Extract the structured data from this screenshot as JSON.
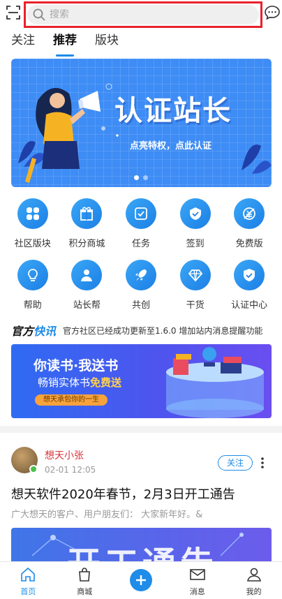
{
  "search": {
    "placeholder": "搜索"
  },
  "tabs": [
    {
      "label": "关注"
    },
    {
      "label": "推荐",
      "active": true
    },
    {
      "label": "版块"
    }
  ],
  "banner": {
    "title": "认证站长",
    "subtitle": "点亮特权，点此认证",
    "page_count": 2,
    "current_page": 1
  },
  "grid": [
    {
      "label": "社区版块",
      "icon": "apps-icon"
    },
    {
      "label": "积分商城",
      "icon": "gift-icon"
    },
    {
      "label": "任务",
      "icon": "task-icon"
    },
    {
      "label": "签到",
      "icon": "checkin-icon"
    },
    {
      "label": "免费版",
      "icon": "free-icon"
    },
    {
      "label": "帮助",
      "icon": "bulb-icon"
    },
    {
      "label": "站长帮",
      "icon": "person-icon"
    },
    {
      "label": "共创",
      "icon": "rocket-icon"
    },
    {
      "label": "干货",
      "icon": "diamond-icon"
    },
    {
      "label": "认证中心",
      "icon": "shield-icon"
    }
  ],
  "news": {
    "logo_a": "官方",
    "logo_b": "快讯",
    "text": "官方社区已经成功更新至1.6.0 增加站内消息提醒功能"
  },
  "ad": {
    "title": "你读书·我送书",
    "sub_a": "畅销实体书",
    "sub_b": "免费送",
    "tag": "想天承包你的一生"
  },
  "post": {
    "author": "想天小张",
    "time": "02-01 12:05",
    "follow_label": "关注",
    "title": "想天软件2020年春节，2月3日开工通告",
    "excerpt": "广大想天的客户、用户朋友们：  大家新年好。&",
    "image_text": "开工通告"
  },
  "bottom_nav": [
    {
      "label": "首页",
      "icon": "home-icon",
      "active": true
    },
    {
      "label": "商城",
      "icon": "bag-icon"
    },
    {
      "label": "",
      "icon": "plus-icon"
    },
    {
      "label": "消息",
      "icon": "mail-icon"
    },
    {
      "label": "我的",
      "icon": "user-icon"
    }
  ],
  "colors": {
    "accent": "#1e8ce8",
    "highlight_border": "#e8222b",
    "author": "#d9323a"
  }
}
